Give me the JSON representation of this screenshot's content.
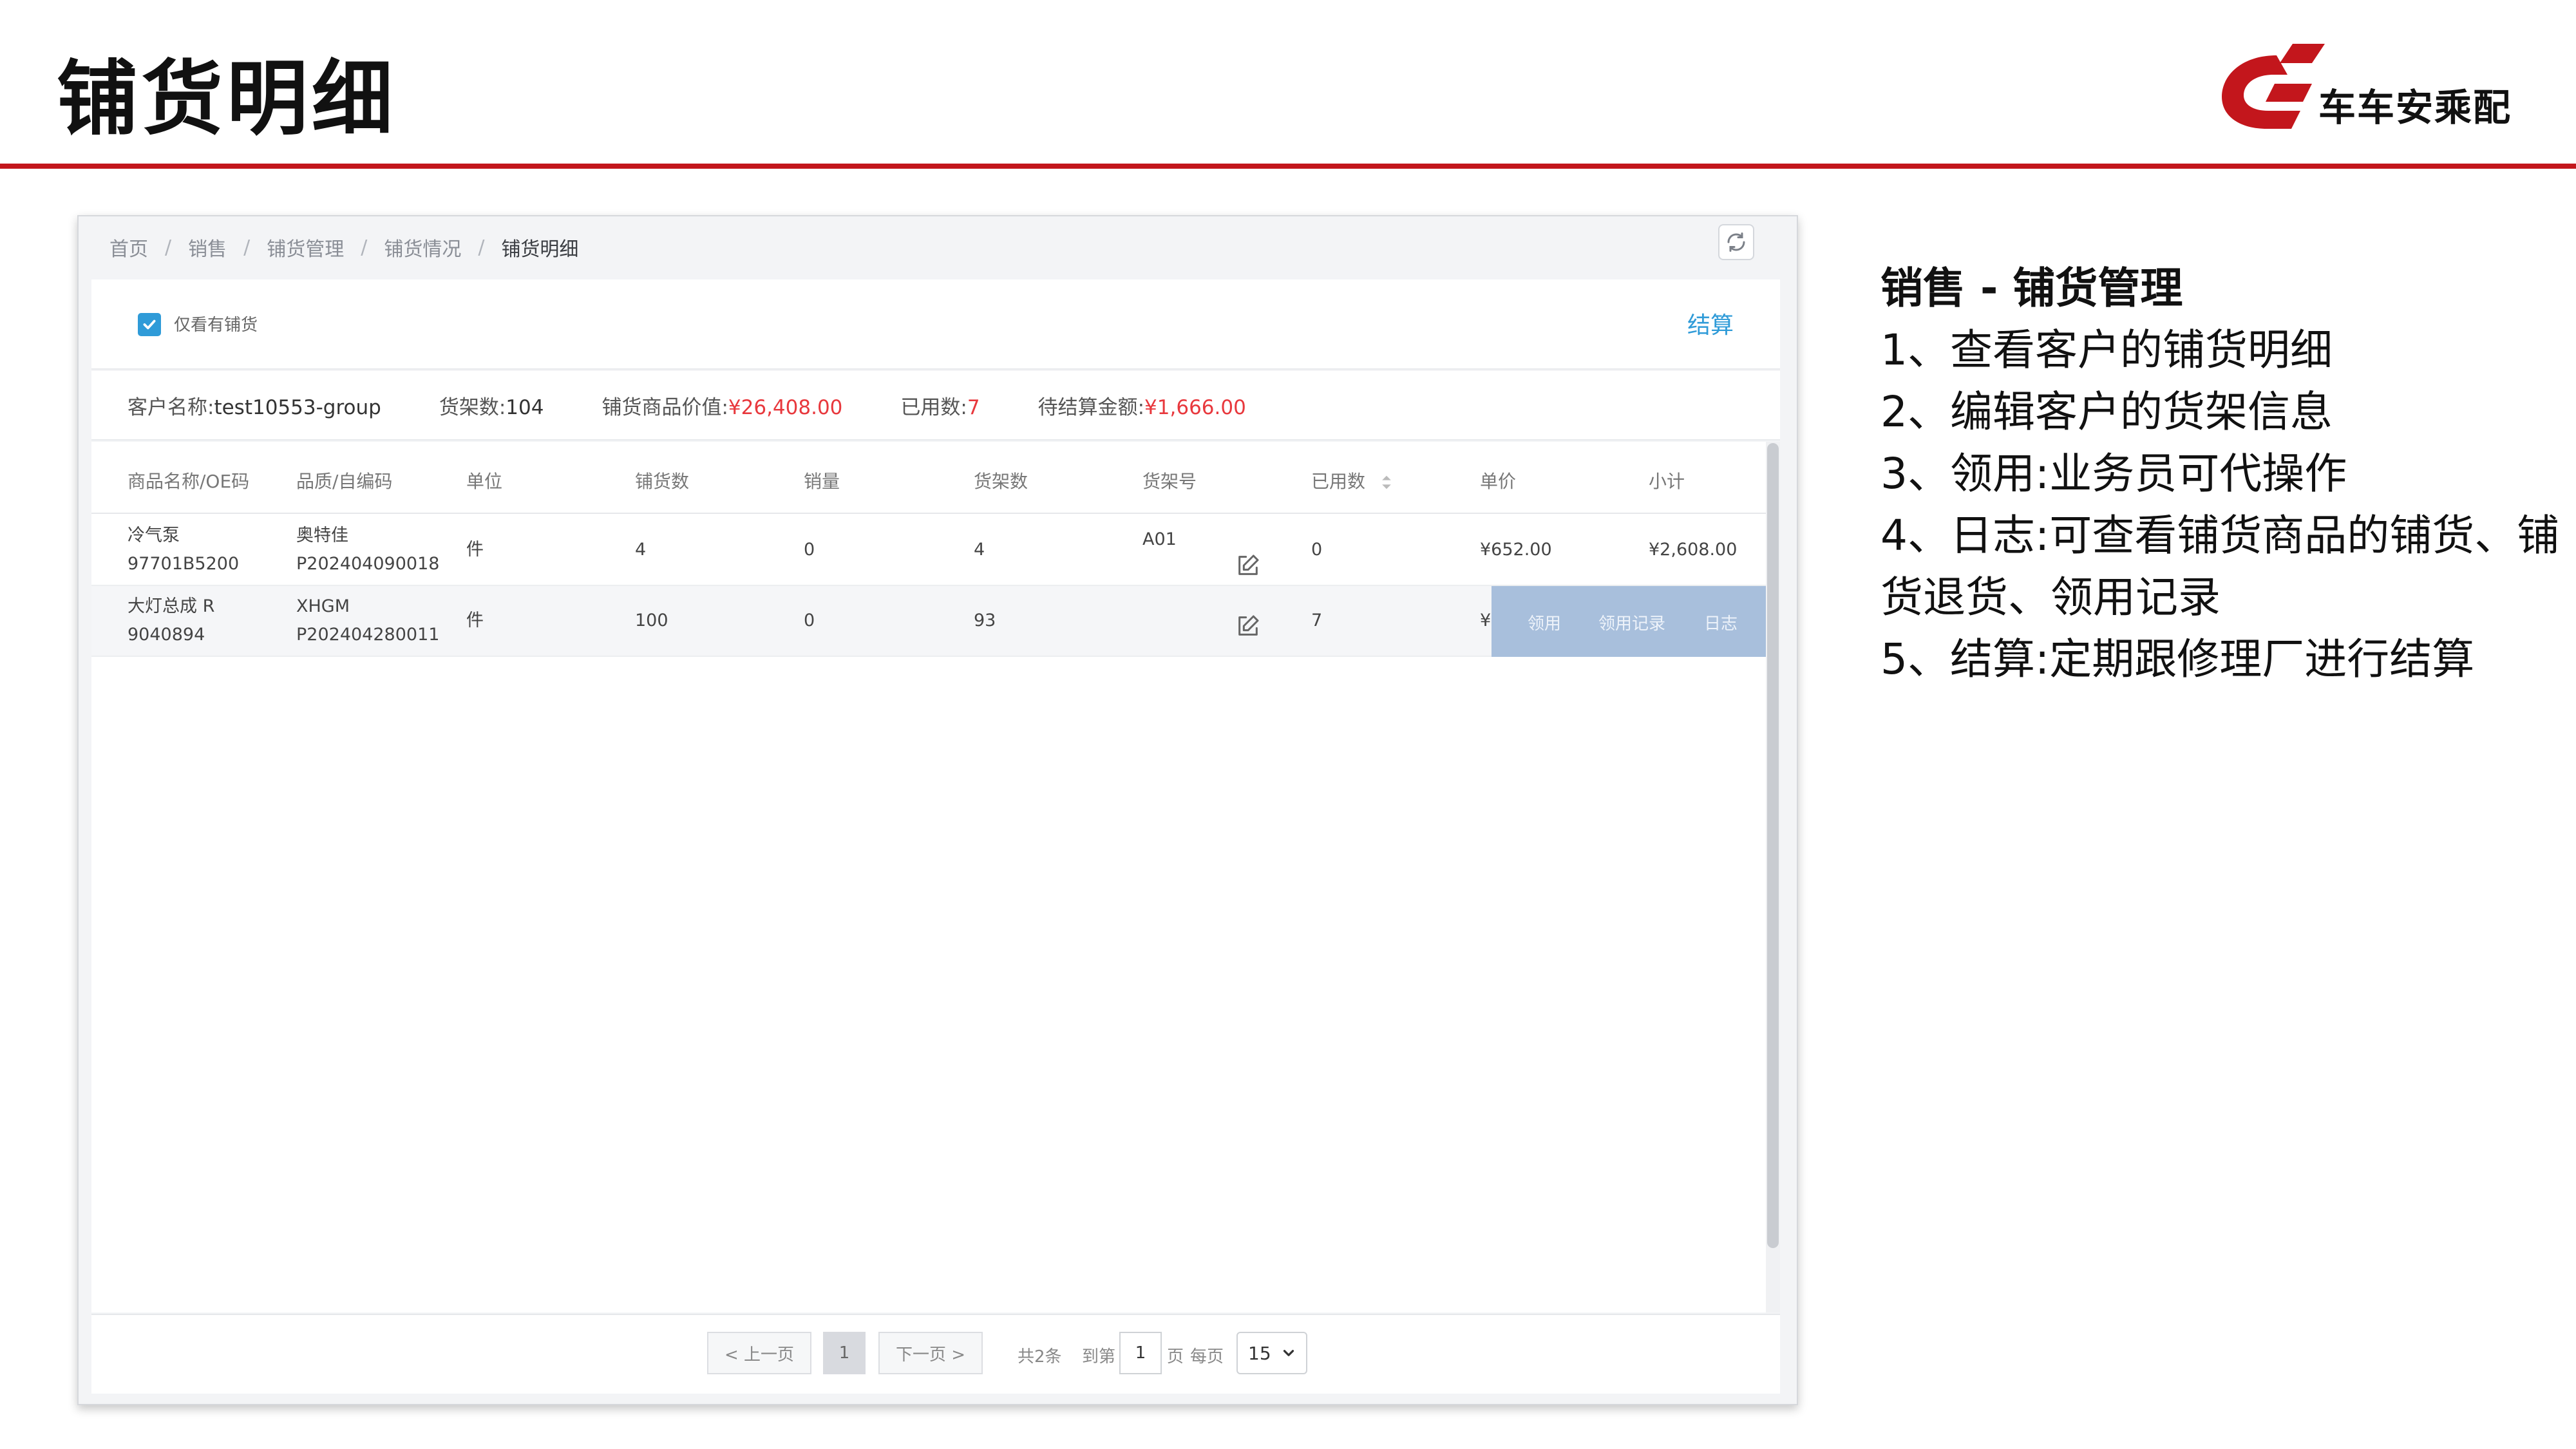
{
  "slide": {
    "title": "铺货明细",
    "logo_text": "车车安乘配",
    "brand_color": "#c3161c"
  },
  "breadcrumb": [
    "首页",
    "销售",
    "铺货管理",
    "铺货情况",
    "铺货明细"
  ],
  "filter": {
    "checkbox_label": "仅看有铺货",
    "checked": true,
    "settle_label": "结算"
  },
  "summary": {
    "customer_label": "客户名称:",
    "customer_value": "test10553-group",
    "shelves_label": "货架数:",
    "shelves_value": "104",
    "goods_value_label": "铺货商品价值:",
    "goods_value": "¥26,408.00",
    "used_label": "已用数:",
    "used_value": "7",
    "pending_label": "待结算金额:",
    "pending_value": "¥1,666.00"
  },
  "table": {
    "headers": [
      "商品名称/OE码",
      "品质/自编码",
      "单位",
      "铺货数",
      "销量",
      "货架数",
      "货架号",
      "已用数",
      "单价",
      "小计"
    ],
    "rows": [
      {
        "name": "冷气泵",
        "oe": "97701B5200",
        "quality": "奥特佳",
        "code": "P202404090018",
        "unit": "件",
        "stock": "4",
        "sales": "0",
        "shelf_count": "4",
        "shelf_no": "A01",
        "used": "0",
        "price": "¥652.00",
        "subtotal": "¥2,608.00"
      },
      {
        "name": "大灯总成 R",
        "oe": "9040894",
        "quality": "XHGM",
        "code": "P202404280011",
        "unit": "件",
        "stock": "100",
        "sales": "0",
        "shelf_count": "93",
        "shelf_no": "",
        "used": "7",
        "price": "¥:",
        "subtotal": ""
      }
    ],
    "row_actions": [
      "领用",
      "领用记录",
      "日志"
    ]
  },
  "pager": {
    "prev": "< 上一页",
    "current": "1",
    "next": "下一页 >",
    "total": "共2条",
    "goto_label": "到第",
    "goto_value": "1",
    "page_label": "页",
    "per_page_label": "每页",
    "per_page_value": "15"
  },
  "notes": {
    "heading": "销售 - 铺货管理",
    "items": [
      "1、查看客户的铺货明细",
      "2、编辑客户的货架信息",
      "3、领用:业务员可代操作",
      "4、日志:可查看铺货商品的铺货、铺货退货、领用记录",
      "5、结算:定期跟修理厂进行结算"
    ]
  }
}
